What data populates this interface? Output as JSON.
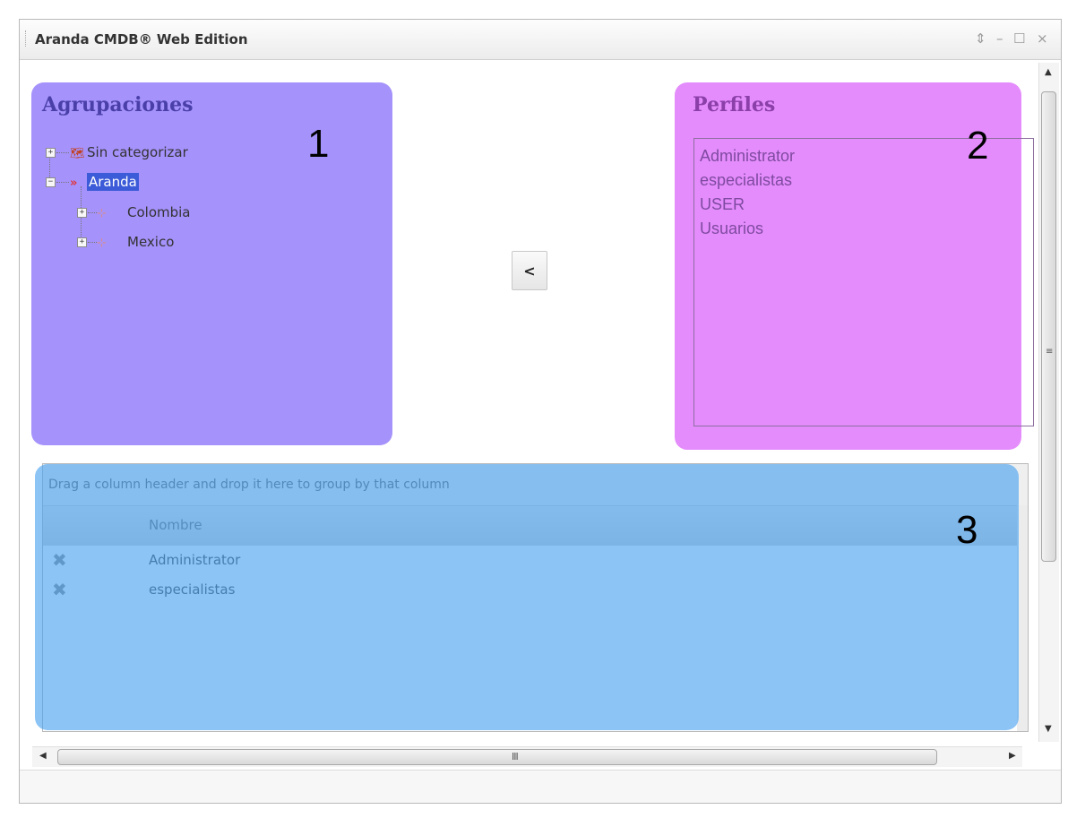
{
  "window": {
    "title": "Aranda CMDB® Web Edition",
    "controls": {
      "restore": "⇕",
      "minimize": "–",
      "maximize": "☐",
      "close": "×"
    }
  },
  "agrupaciones": {
    "title": "Agrupaciones",
    "number": "1",
    "tree": [
      {
        "label": "Sin categorizar",
        "icon": "world-folder-icon",
        "expander": "+"
      },
      {
        "label": "Aranda",
        "icon": "chevron-double-icon",
        "expander": "−",
        "selected": true
      },
      {
        "label": "Colombia",
        "icon": "network-icon",
        "expander": "+"
      },
      {
        "label": "Mexico",
        "icon": "network-icon",
        "expander": "+"
      }
    ]
  },
  "move_button": {
    "label": "<"
  },
  "perfiles": {
    "title": "Perfiles",
    "number": "2",
    "items": [
      "Administrator",
      "especialistas",
      "USER",
      "Usuarios"
    ]
  },
  "grid": {
    "number": "3",
    "group_hint": "Drag a column header and drop it here to group by that column",
    "column_header": "Nombre",
    "rows": [
      {
        "name": "Administrator",
        "icon": "delete-x-icon"
      },
      {
        "name": "especialistas",
        "icon": "delete-x-icon"
      }
    ]
  },
  "scrollbars": {
    "grip_h": "III",
    "grip_v": "≡"
  },
  "colors": {
    "agrupaciones_panel": "#a592fb",
    "perfiles_panel": "#e48cfc",
    "grid_overlay": "#46a0f0"
  }
}
